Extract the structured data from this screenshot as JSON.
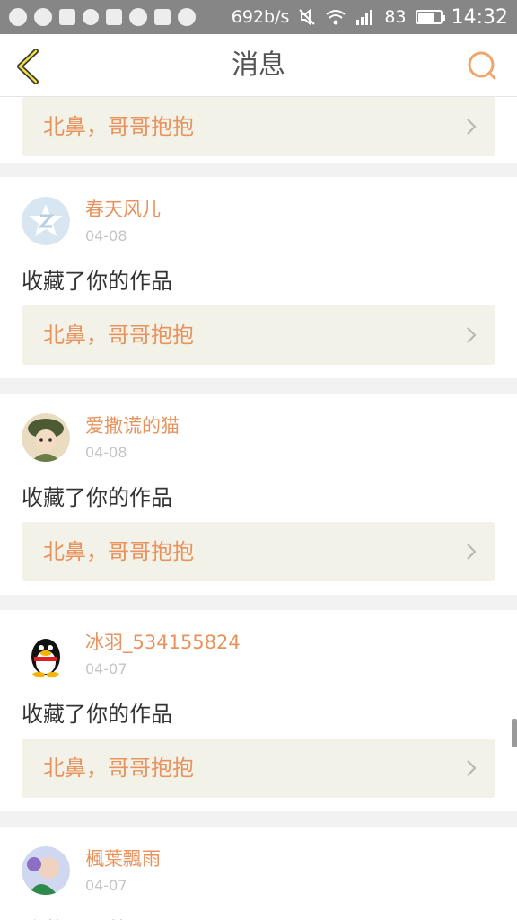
{
  "status_bar": {
    "net_speed": "692b/s",
    "battery_level": "83",
    "battery_fill": 0.83,
    "time": "14:32",
    "icons": [
      "sync-icon",
      "chat-icon",
      "image-icon",
      "heart-icon",
      "location-icon",
      "weather-icon",
      "leme-icon",
      "more-icon",
      "mute-icon",
      "wifi-icon",
      "signal-icon",
      "battery-icon"
    ]
  },
  "header": {
    "title": "消息"
  },
  "messages": [
    {
      "work_title": "北鼻，哥哥抱抱"
    },
    {
      "user": "春天风儿",
      "date": "04-08",
      "action": "收藏了你的作品",
      "work_title": "北鼻，哥哥抱抱"
    },
    {
      "user": "爱撒谎的猫",
      "date": "04-08",
      "action": "收藏了你的作品",
      "work_title": "北鼻，哥哥抱抱"
    },
    {
      "user": "冰羽_534155824",
      "date": "04-07",
      "action": "收藏了你的作品",
      "work_title": "北鼻，哥哥抱抱"
    },
    {
      "user": "楓葉飄雨",
      "date": "04-07",
      "action": "收藏了你的作品"
    }
  ],
  "colors": {
    "accent": "#e8935d",
    "card_bg": "#f3f2e8",
    "status_bar": "#868686"
  }
}
